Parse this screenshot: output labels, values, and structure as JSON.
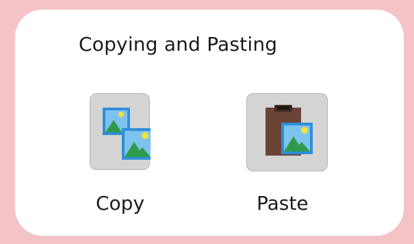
{
  "panel": {
    "title": "Copying and Pasting"
  },
  "tools": [
    {
      "label": "Copy",
      "icon": "copy-images-icon"
    },
    {
      "label": "Paste",
      "icon": "paste-clipboard-image-icon"
    }
  ],
  "colors": {
    "background": "#f4c3c6",
    "card": "#ffffff",
    "button": "#d4d4d4",
    "image_frame": "#2e8fd8",
    "image_sky": "#7ec3ef",
    "mountain": "#2e9b4a",
    "sun": "#f2e23a",
    "clipboard": "#6b4337"
  }
}
